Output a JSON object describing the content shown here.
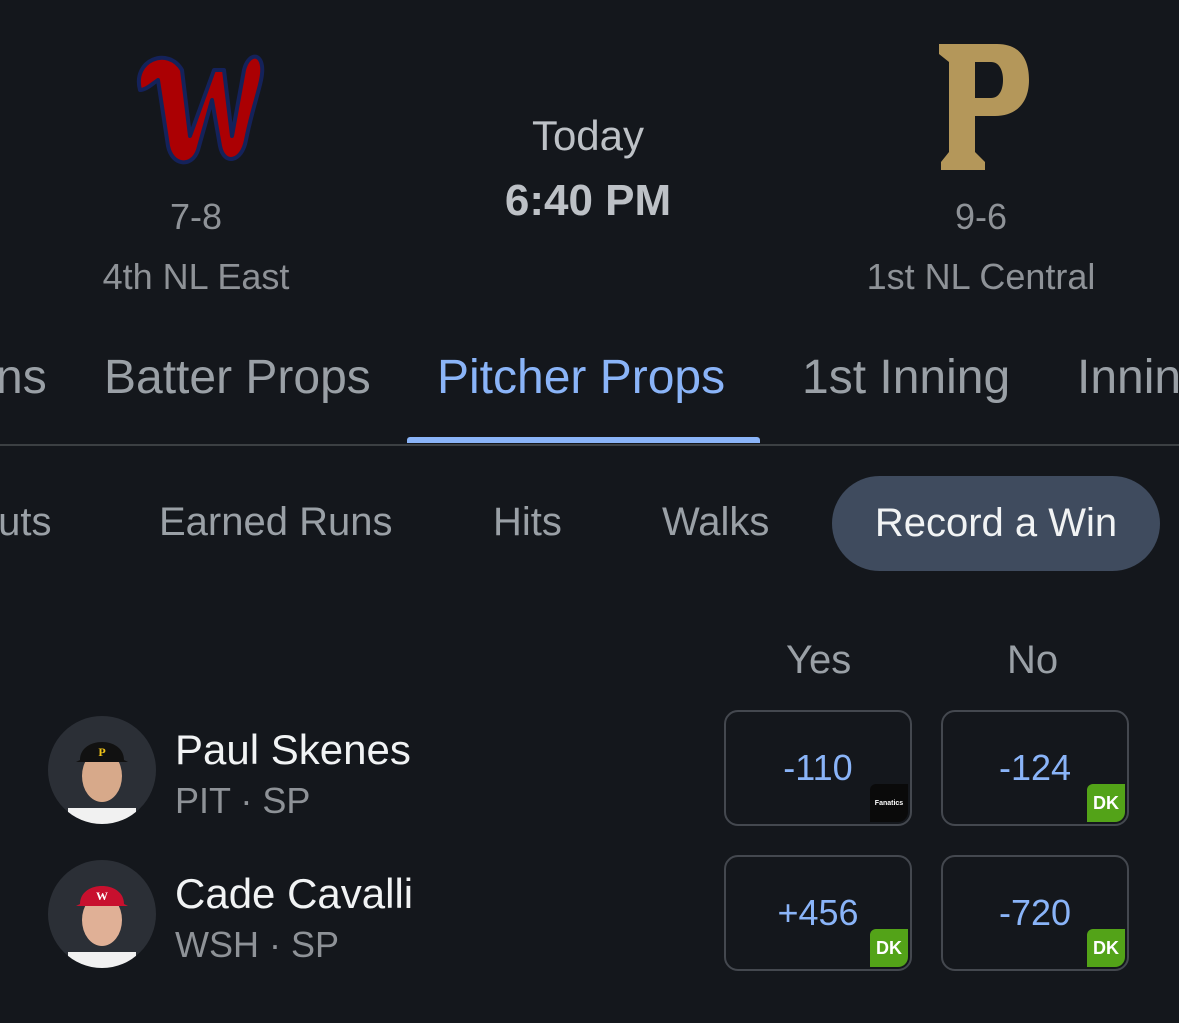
{
  "game": {
    "away": {
      "team": "Washington Nationals",
      "logo_icon": "nationals-w-logo-icon",
      "record": "7-8",
      "standing": "4th NL East",
      "color": "#ab0003"
    },
    "home": {
      "team": "Pittsburgh Pirates",
      "logo_icon": "pirates-p-logo-icon",
      "record": "9-6",
      "standing": "1st NL Central",
      "color": "#b4975a"
    },
    "day": "Today",
    "time": "6:40 PM"
  },
  "tabs": [
    {
      "label": "ns"
    },
    {
      "label": "Batter Props"
    },
    {
      "label": "Pitcher Props",
      "active": true
    },
    {
      "label": "1st Inning"
    },
    {
      "label": "Innin"
    }
  ],
  "subtabs": [
    {
      "label": "Outs"
    },
    {
      "label": "Earned Runs"
    },
    {
      "label": "Hits"
    },
    {
      "label": "Walks"
    },
    {
      "label": "Record a Win",
      "active": true
    }
  ],
  "columns": {
    "yes": "Yes",
    "no": "No"
  },
  "players": [
    {
      "name": "Paul Skenes",
      "meta": "PIT · SP",
      "avatar_icon": "pirates-player-avatar-icon",
      "yes": {
        "odds": "-110",
        "book": "Fanatics",
        "book_text": "Fanatics"
      },
      "no": {
        "odds": "-124",
        "book": "DraftKings",
        "book_text": "DK"
      }
    },
    {
      "name": "Cade Cavalli",
      "meta": "WSH · SP",
      "avatar_icon": "nationals-player-avatar-icon",
      "yes": {
        "odds": "+456",
        "book": "DraftKings",
        "book_text": "DK"
      },
      "no": {
        "odds": "-720",
        "book": "DraftKings",
        "book_text": "DK"
      }
    }
  ],
  "colors": {
    "accent": "#8ab4f8",
    "background": "#14171c",
    "dk_green": "#53a318",
    "chip_active": "#3f4b5e"
  }
}
